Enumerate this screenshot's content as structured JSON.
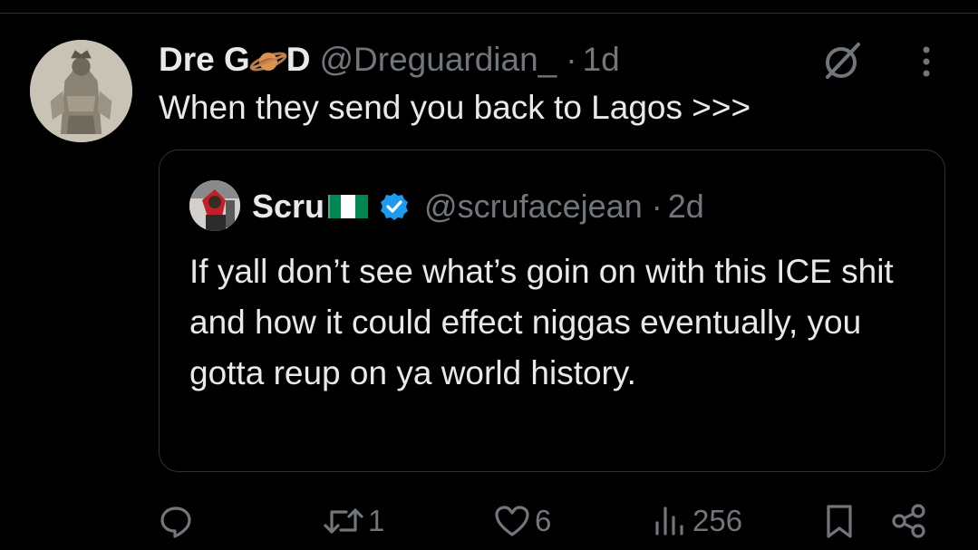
{
  "tweet": {
    "author_name_part1": "Dre G",
    "author_name_part2": "D",
    "author_name_emoji": "ringed-planet-emoji",
    "author_handle": "@Dreguardian_",
    "separator": "·",
    "time": "1d",
    "text": "When they send you back to Lagos >>>"
  },
  "quoted_tweet": {
    "author_name": "Scru",
    "flag_emoji": "nigeria-flag-emoji",
    "verified_icon": "verified-badge-icon",
    "author_handle": "@scrufacejean",
    "separator": "·",
    "time": "2d",
    "text": "If yall don’t see what’s goin on with this ICE shit and how it could effect niggas eventually, you gotta reup on ya world history."
  },
  "actions": {
    "reply_count": "",
    "retweet_count": "1",
    "like_count": "6",
    "view_count": "256"
  },
  "colors": {
    "background": "#000000",
    "text_primary": "#e7e9ea",
    "text_secondary": "#71767b",
    "border": "#2f3336",
    "verified_blue": "#1d9bf0",
    "flag_green": "#008751"
  }
}
